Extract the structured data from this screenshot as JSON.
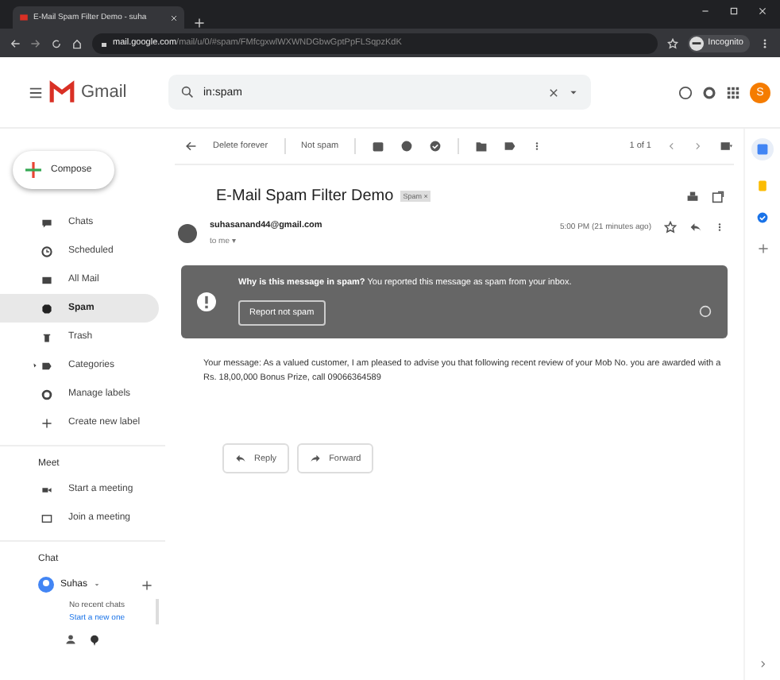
{
  "browser": {
    "tab_title": "E-Mail Spam Filter Demo - suha",
    "url_host": "mail.google.com",
    "url_path": "/mail/u/0/#spam/FMfcgxwlWXWNDGbwGptPpFLSqpzKdK",
    "profile": "Incognito"
  },
  "header": {
    "app_name": "Gmail",
    "search": {
      "value": "in:spam"
    },
    "avatar": "S"
  },
  "sidebar": {
    "compose": "Compose",
    "items": [
      {
        "label": "Chats",
        "selected": false
      },
      {
        "label": "Scheduled",
        "selected": false
      },
      {
        "label": "All Mail",
        "selected": false
      },
      {
        "label": "Spam",
        "selected": true
      },
      {
        "label": "Trash",
        "selected": false
      },
      {
        "label": "Categories",
        "selected": false
      },
      {
        "label": "Manage labels",
        "selected": false
      },
      {
        "label": "Create new label",
        "selected": false
      }
    ],
    "meet_title": "Meet",
    "meet_items": [
      "Start a meeting",
      "Join a meeting"
    ],
    "chat_title": "Chat",
    "chat_user": "Suhas",
    "chat_empty": "No recent chats",
    "chat_link": "Start a new one"
  },
  "toolbar": {
    "actions": [
      "Delete forever",
      "Not spam"
    ],
    "pager": "1 of 1"
  },
  "message": {
    "subject": "E-Mail Spam Filter Demo",
    "label": "Spam",
    "label_remove": "×",
    "sender": "suhasanand44@gmail.com",
    "to": "to me",
    "to_caret": "▾",
    "time": "5:00 PM (21 minutes ago)",
    "warning_title": "Why is this message in spam?",
    "warning_text": "You reported this message as spam from your inbox.",
    "warning_button": "Report not spam",
    "body": "Your message: As a valued customer, I am pleased to advise you that following recent review of your Mob No. you are awarded with a Rs. 18,00,000 Bonus Prize, call 09066364589",
    "buttons": [
      "Reply",
      "Forward"
    ]
  }
}
